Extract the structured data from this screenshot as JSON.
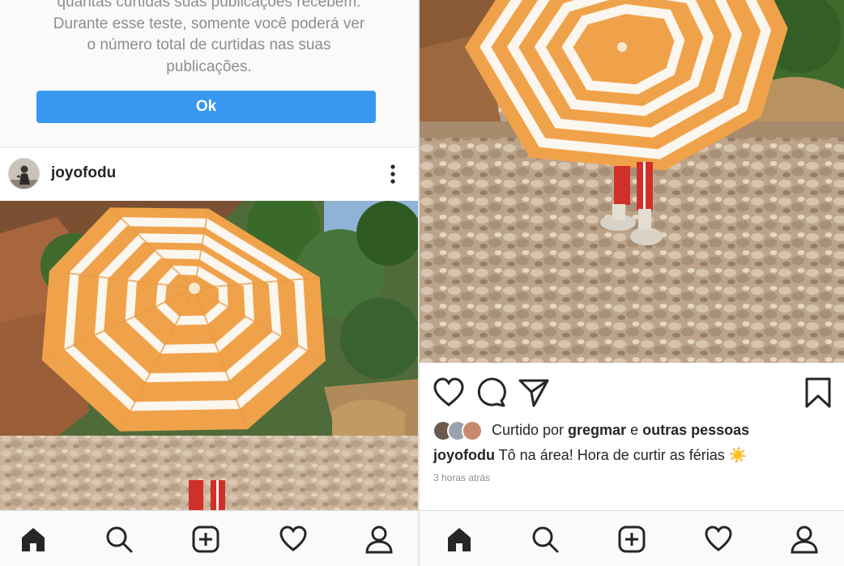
{
  "notice": {
    "text_line1": "quantas curtidas suas publicações recebem.",
    "text_line2": "Durante esse teste, somente você poderá ver",
    "text_line3": "o número total de curtidas nas suas",
    "text_line4": "publicações.",
    "ok_label": "Ok"
  },
  "post": {
    "username": "joyofodu",
    "more_icon": "more-vertical-icon",
    "image_alt": "striped-beach-umbrella-photo"
  },
  "actions": {
    "like_icon": "heart-icon",
    "comment_icon": "comment-icon",
    "share_icon": "send-icon",
    "save_icon": "bookmark-icon"
  },
  "likes": {
    "prefix": "Curtido por ",
    "user": "gregmar",
    "conjunction": " e ",
    "others": "outras pessoas"
  },
  "caption": {
    "user": "joyofodu",
    "text": " Tô na área! Hora de curtir as férias ☀️"
  },
  "timestamp": "3 horas atrás",
  "nav": {
    "home_icon": "home-icon",
    "search_icon": "search-icon",
    "add_icon": "add-post-icon",
    "activity_icon": "heart-icon",
    "profile_icon": "profile-icon"
  },
  "colors": {
    "accent": "#3897f0",
    "umbrella_orange": "#f0a24a",
    "umbrella_white": "#fbf6ee"
  }
}
